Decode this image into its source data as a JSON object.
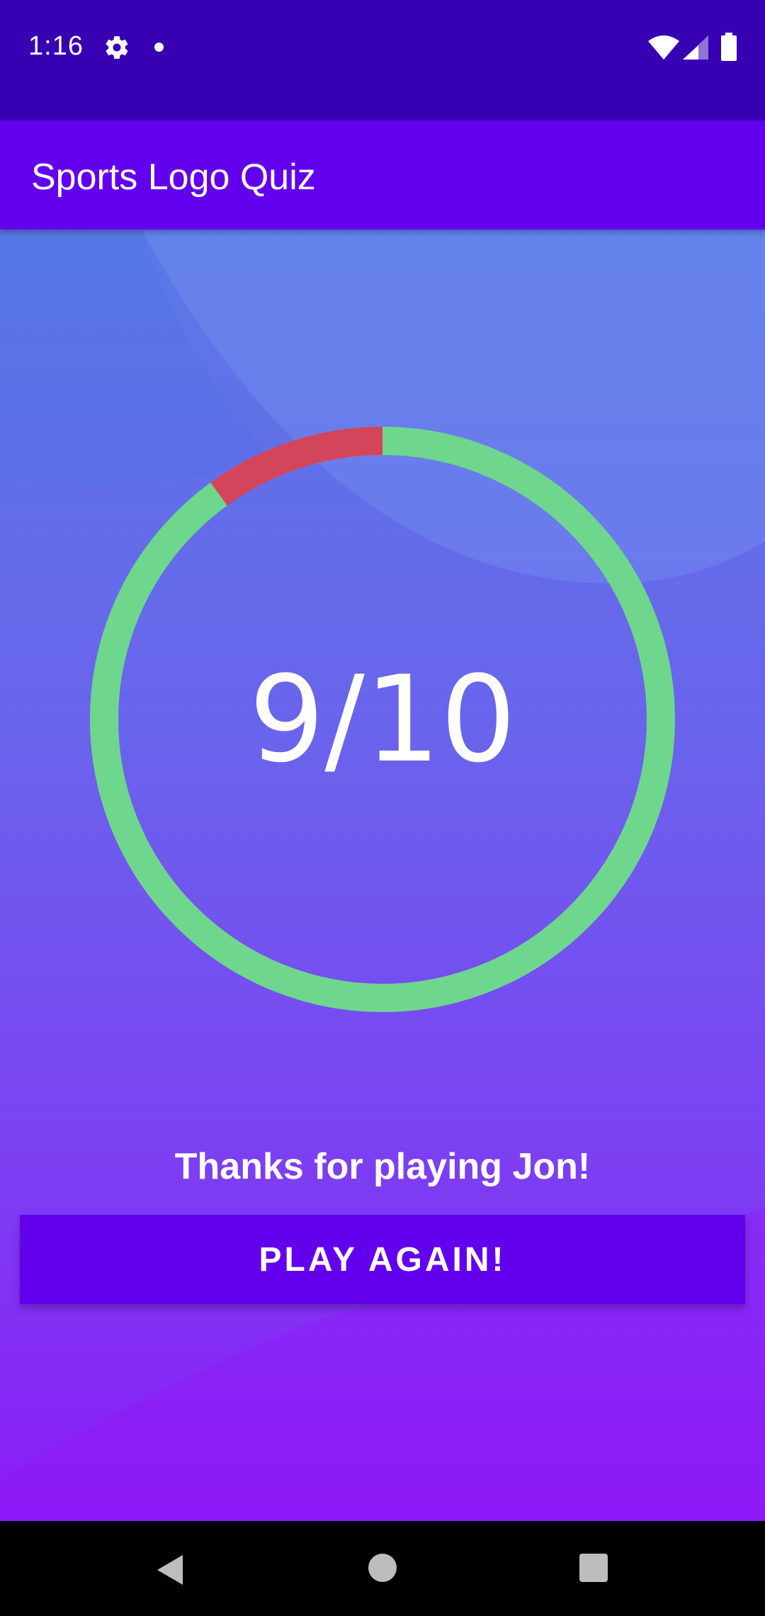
{
  "status_bar": {
    "time": "1:16",
    "icons": [
      "gear-icon",
      "notification-dot-icon",
      "wifi-icon",
      "cell-signal-icon",
      "battery-icon"
    ]
  },
  "app_bar": {
    "title": "Sports Logo Quiz"
  },
  "result": {
    "score_text": "9/10",
    "correct": 9,
    "total": 10,
    "colors": {
      "correct": "#6fd68d",
      "wrong": "#d2455a"
    }
  },
  "message": "Thanks for playing Jon!",
  "play_again_label": "PLAY AGAIN!",
  "nav_bar": {
    "icons": [
      "back-icon",
      "home-icon",
      "recent-apps-icon"
    ]
  },
  "colors": {
    "status_bar": "#3700b3",
    "app_bar": "#6200ee",
    "button": "#6200ee"
  }
}
